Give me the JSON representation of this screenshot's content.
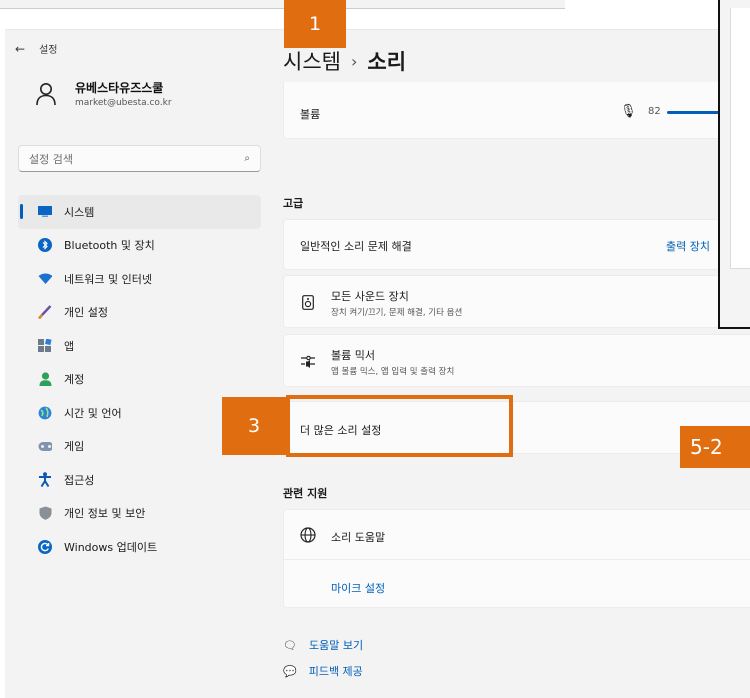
{
  "window": {
    "title": "설정"
  },
  "profile": {
    "name": "유베스타유즈스쿨",
    "email": "market@ubesta.co.kr"
  },
  "search": {
    "placeholder": "설정 검색"
  },
  "sidebar": {
    "items": [
      {
        "label": "시스템",
        "icon": "system-icon",
        "active": true
      },
      {
        "label": "Bluetooth 및 장치",
        "icon": "bluetooth-icon"
      },
      {
        "label": "네트워크 및 인터넷",
        "icon": "network-icon"
      },
      {
        "label": "개인 설정",
        "icon": "brush-icon"
      },
      {
        "label": "앱",
        "icon": "apps-icon"
      },
      {
        "label": "계정",
        "icon": "account-icon"
      },
      {
        "label": "시간 및 언어",
        "icon": "globe-clock-icon"
      },
      {
        "label": "게임",
        "icon": "gamepad-icon"
      },
      {
        "label": "접근성",
        "icon": "accessibility-icon"
      },
      {
        "label": "개인 정보 및 보안",
        "icon": "shield-icon"
      },
      {
        "label": "Windows 업데이트",
        "icon": "update-icon"
      }
    ]
  },
  "breadcrumb": {
    "parent": "시스템",
    "separator": "›",
    "current": "소리"
  },
  "volume": {
    "label": "볼륨",
    "value": "82",
    "level": 0.82
  },
  "advanced": {
    "title": "고급",
    "troubleshoot": {
      "label": "일반적인 소리 문제 해결",
      "link": "출력 장치"
    },
    "all_devices": {
      "label": "모든 사운드 장치",
      "sub": "장치 켜기/끄기, 문제 해결, 기타 옵션"
    },
    "mixer": {
      "label": "볼륨 믹서",
      "sub": "앱 볼륨 믹스, 앱 입력 및 출력 장치"
    },
    "more": {
      "label": "더 많은 소리 설정"
    }
  },
  "support": {
    "title": "관련 지원",
    "help": {
      "label": "소리 도움말"
    },
    "mic_link": "마이크 설정"
  },
  "footer": {
    "help": "도움말 보기",
    "feedback": "피드백 제공"
  },
  "annotations": {
    "tag1": "1",
    "tag3": "3",
    "tag52": "5-2"
  },
  "colors": {
    "accent": "#005fb8",
    "annotation": "#e06d10"
  }
}
